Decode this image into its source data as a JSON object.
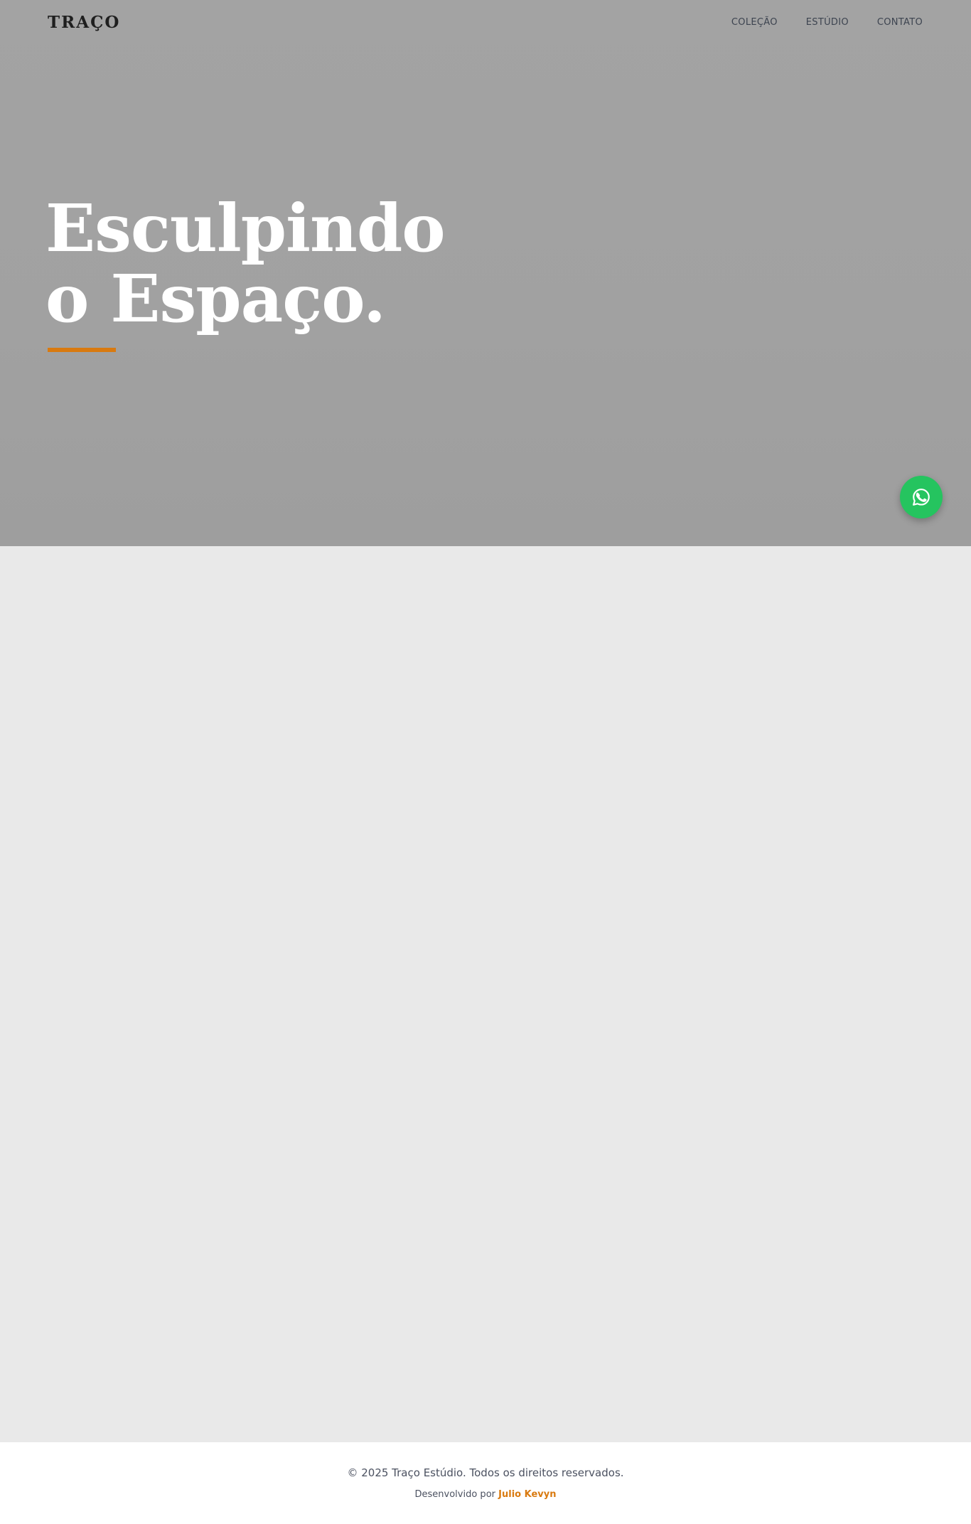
{
  "header": {
    "logo": "TRAÇO",
    "nav": [
      {
        "label": "COLEÇÃO"
      },
      {
        "label": "ESTÚDIO"
      },
      {
        "label": "CONTATO"
      }
    ]
  },
  "hero": {
    "title_line1": "Esculpindo",
    "title_line2": "o Espaço.",
    "accent_color": "#d97a10"
  },
  "floating_button": {
    "icon": "whatsapp-icon",
    "color": "#25c45f"
  },
  "footer": {
    "copyright": "© 2025 Traço Estúdio. Todos os direitos reservados.",
    "credit_prefix": "Desenvolvido por",
    "credit_name": "Julio Kevyn"
  }
}
